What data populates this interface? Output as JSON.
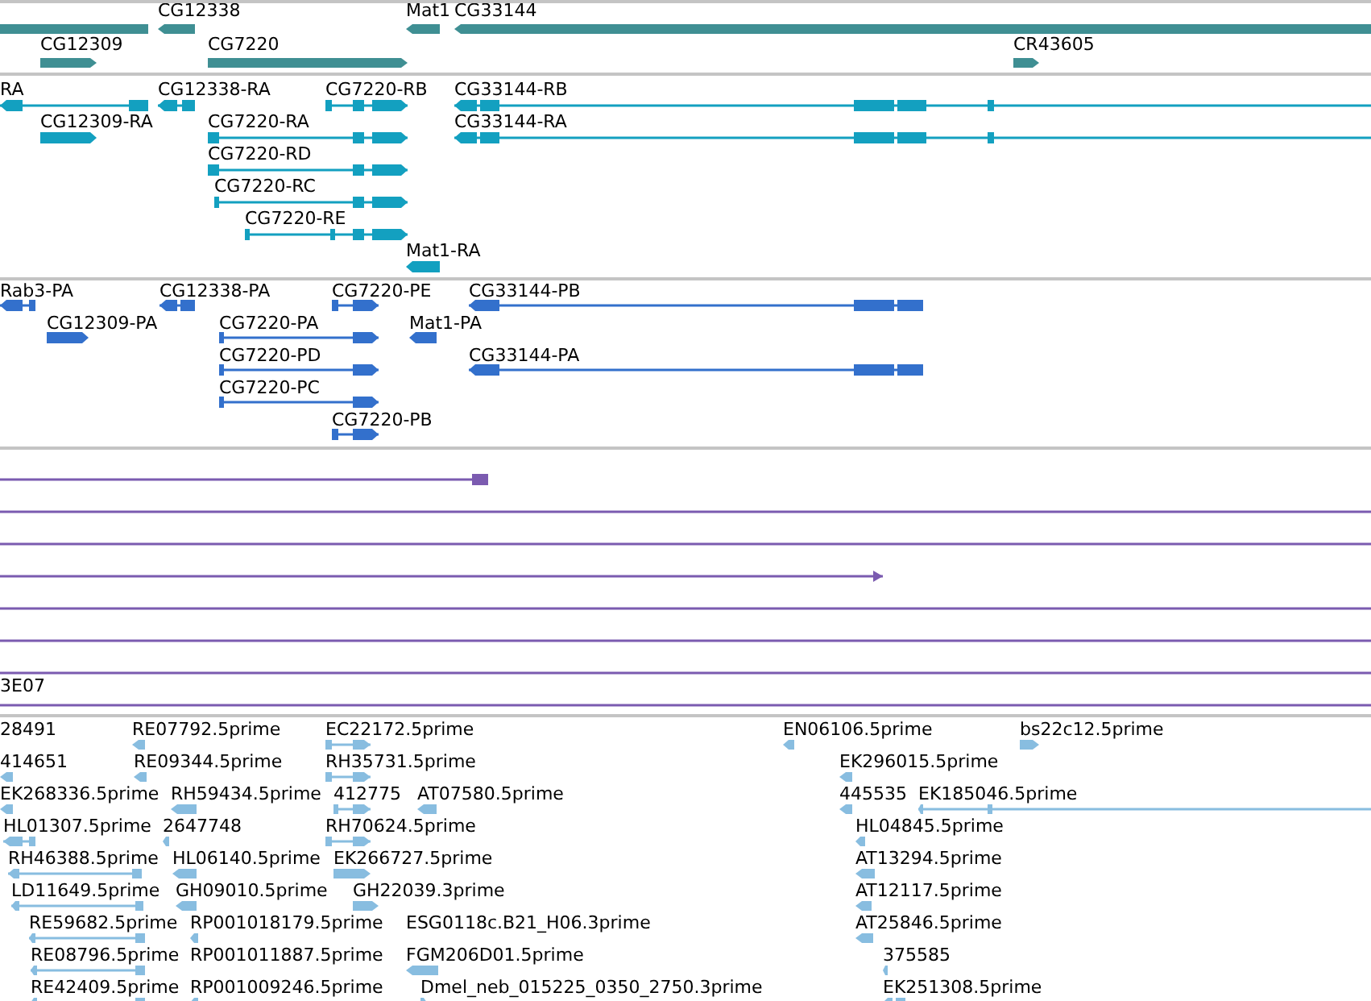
{
  "tracks": [
    {
      "kind": "gene",
      "color": "#3f8f93",
      "features": [
        {
          "kind": "plain"
        },
        {
          "label": "CG12338",
          "reverse": true
        },
        {
          "label": "Mat1",
          "reverse": true
        },
        {
          "label": "CG33144",
          "reverse": true
        },
        {
          "label": "CG12309",
          "reverse": false
        },
        {
          "label": "CG7220",
          "reverse": false
        },
        {
          "label": "CR43605",
          "reverse": false
        }
      ]
    },
    {
      "kind": "transcript",
      "color": "#13a0c0",
      "features": [
        {
          "label": "RA",
          "reverse": true
        },
        {
          "label": "CG12338-RA",
          "reverse": true
        },
        {
          "label": "CG7220-RB",
          "reverse": false
        },
        {
          "label": "CG33144-RB",
          "reverse": true
        },
        {
          "label": "CG12309-RA",
          "reverse": false
        },
        {
          "label": "CG7220-RA",
          "reverse": false
        },
        {
          "label": "CG33144-RA",
          "reverse": true
        },
        {
          "label": "CG7220-RD",
          "reverse": false
        },
        {
          "label": "CG7220-RC",
          "reverse": false
        },
        {
          "label": "CG7220-RE",
          "reverse": false
        },
        {
          "label": "Mat1-RA",
          "reverse": true
        }
      ]
    },
    {
      "kind": "protein",
      "color": "#3370cc",
      "features": [
        {
          "label": "Rab3-PA",
          "reverse": true
        },
        {
          "label": "CG12338-PA",
          "reverse": true
        },
        {
          "label": "CG7220-PE",
          "reverse": false
        },
        {
          "label": "CG33144-PB",
          "reverse": true
        },
        {
          "label": "CG12309-PA",
          "reverse": false
        },
        {
          "label": "CG7220-PA",
          "reverse": false
        },
        {
          "label": "Mat1-PA",
          "reverse": true
        },
        {
          "label": "CG7220-PD",
          "reverse": false
        },
        {
          "label": "CG33144-PA",
          "reverse": true
        },
        {
          "label": "CG7220-PC",
          "reverse": false
        },
        {
          "label": "CG7220-PB",
          "reverse": false
        }
      ]
    },
    {
      "kind": "match",
      "color": "#7b5bb0",
      "features": [
        {
          "kind": "plain"
        },
        {
          "kind": "plain"
        },
        {
          "kind": "plain"
        },
        {
          "reverse": false
        },
        {
          "kind": "plain"
        },
        {
          "kind": "plain"
        },
        {
          "kind": "plain"
        },
        {
          "label": "3E07",
          "kind": "plain"
        }
      ]
    },
    {
      "kind": "est",
      "color": "#88bde0",
      "features": [
        {
          "label": "28491"
        },
        {
          "label": "RE07792.5prime",
          "reverse": true
        },
        {
          "label": "EC22172.5prime",
          "reverse": false
        },
        {
          "label": "EN06106.5prime",
          "reverse": true
        },
        {
          "label": "bs22c12.5prime",
          "reverse": false
        },
        {
          "label": "414651",
          "reverse": true
        },
        {
          "label": "RE09344.5prime",
          "reverse": true
        },
        {
          "label": "RH35731.5prime",
          "reverse": false
        },
        {
          "label": "EK296015.5prime",
          "reverse": true
        },
        {
          "label": "EK268336.5prime",
          "reverse": true
        },
        {
          "label": "RH59434.5prime",
          "reverse": true
        },
        {
          "label": "412775",
          "reverse": false
        },
        {
          "label": "AT07580.5prime",
          "reverse": true
        },
        {
          "label": "445535",
          "reverse": true
        },
        {
          "label": "EK185046.5prime",
          "reverse": true
        },
        {
          "label": "HL01307.5prime",
          "reverse": true
        },
        {
          "label": "2647748",
          "reverse": true
        },
        {
          "label": "RH70624.5prime",
          "reverse": false
        },
        {
          "label": "HL04845.5prime",
          "reverse": true
        },
        {
          "label": "RH46388.5prime",
          "reverse": true
        },
        {
          "label": "HL06140.5prime",
          "reverse": true
        },
        {
          "label": "EK266727.5prime",
          "reverse": false
        },
        {
          "label": "AT13294.5prime",
          "reverse": true
        },
        {
          "label": "LD11649.5prime",
          "reverse": true
        },
        {
          "label": "GH09010.5prime",
          "reverse": true
        },
        {
          "label": "GH22039.3prime",
          "reverse": false
        },
        {
          "label": "AT12117.5prime",
          "reverse": true
        },
        {
          "label": "RE59682.5prime",
          "reverse": true
        },
        {
          "label": "RP001018179.5prime",
          "reverse": true
        },
        {
          "label": "ESG0118c.B21_H06.3prime"
        },
        {
          "label": "AT25846.5prime",
          "reverse": true
        },
        {
          "label": "RE08796.5prime",
          "reverse": true
        },
        {
          "label": "RP001011887.5prime"
        },
        {
          "label": "FGM206D01.5prime",
          "reverse": true
        },
        {
          "label": "375585",
          "reverse": true
        },
        {
          "label": "RE42409.5prime",
          "reverse": true
        },
        {
          "label": "RP001009246.5prime",
          "reverse": true
        },
        {
          "label": "Dmel_neb_015225_0350_2750.3prime",
          "reverse": false
        },
        {
          "label": "EK251308.5prime",
          "reverse": true
        }
      ]
    }
  ]
}
